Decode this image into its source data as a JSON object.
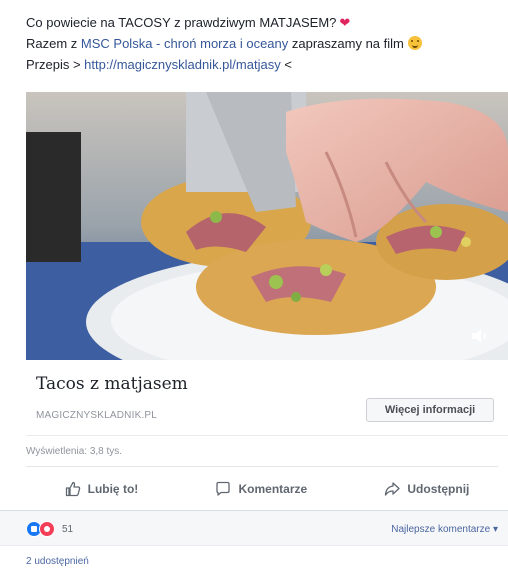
{
  "post": {
    "line1": "Co powiecie na TACOSY z prawdziwym MATJASEM?",
    "line2_before": "Razem z ",
    "line2_link": "MSC Polska - chroń morza i oceany",
    "line2_after": " zapraszamy na film",
    "line3_prefix": "Przepis > ",
    "line3_link": "http://magicznyskladnik.pl/matjasy",
    "line3_suffix": " <"
  },
  "link_preview": {
    "title": "Tacos z matjasem",
    "domain": "MAGICZNYSKLADNIK.PL",
    "button_label": "Więcej informacji"
  },
  "stats": {
    "views": "Wyświetlenia: 3,8 tys."
  },
  "actions": {
    "like": "Lubię to!",
    "comment": "Komentarze",
    "share": "Udostępnij"
  },
  "reactions": {
    "count": "51",
    "sort_label": "Najlepsze komentarze ▾"
  },
  "shares": {
    "label": "2 udostępnień"
  },
  "icons": {
    "heart": "heart-icon",
    "emoji": "smiling-face-icon",
    "volume": "volume-icon",
    "like": "thumbs-up-icon",
    "comment": "speech-bubble-icon",
    "share": "share-arrow-icon",
    "reaction_like": "like-reaction-icon",
    "reaction_love": "love-reaction-icon"
  },
  "colors": {
    "link": "#365899",
    "heart": "#e0245e",
    "like_reaction": "#1877f2",
    "love_reaction": "#f33e58"
  }
}
